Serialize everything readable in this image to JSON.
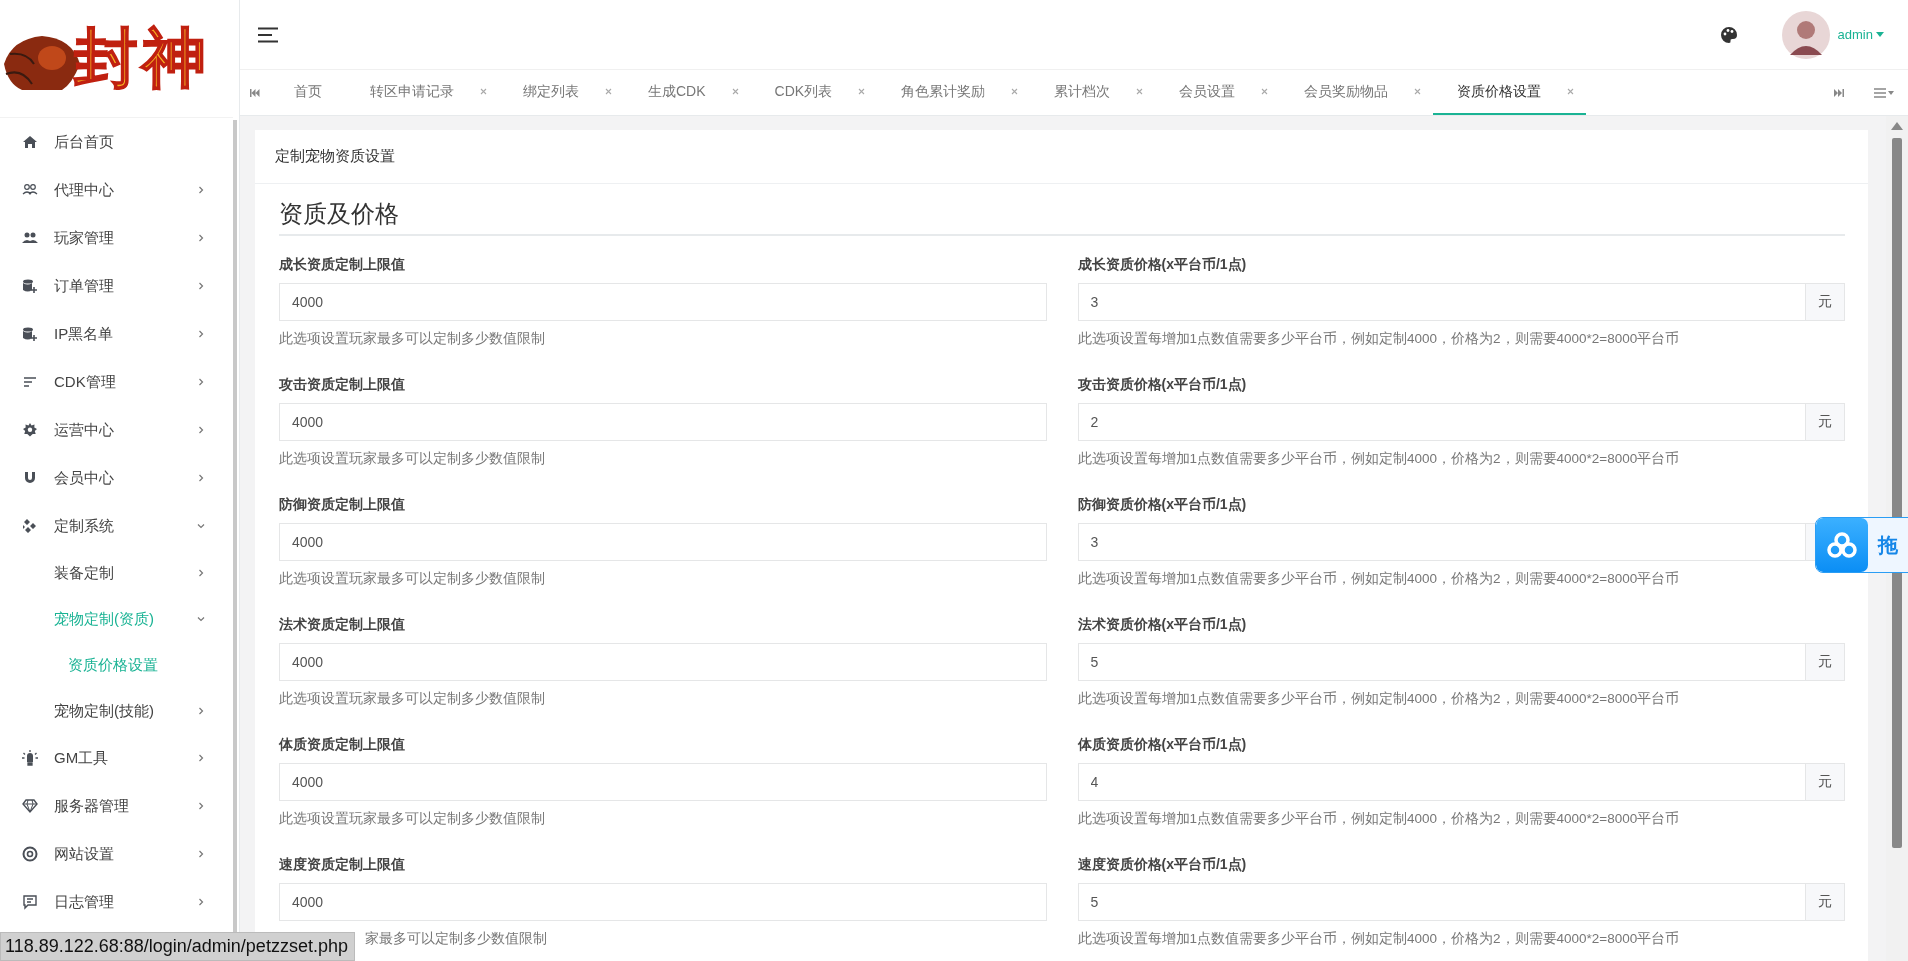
{
  "logo": {
    "text": "封神"
  },
  "sidebar": {
    "items": [
      {
        "label": "后台首页",
        "selected": false
      },
      {
        "label": "代理中心",
        "selected": false,
        "expanded": false
      },
      {
        "label": "玩家管理",
        "selected": false,
        "expanded": false
      },
      {
        "label": "订单管理",
        "selected": false,
        "expanded": false
      },
      {
        "label": "IP黑名单",
        "selected": false,
        "expanded": false
      },
      {
        "label": "CDK管理",
        "selected": false,
        "expanded": false
      },
      {
        "label": "运营中心",
        "selected": false,
        "expanded": false
      },
      {
        "label": "会员中心",
        "selected": false,
        "expanded": false
      },
      {
        "label": "定制系统",
        "selected": false,
        "expanded": true,
        "children": [
          {
            "label": "装备定制",
            "selected": false,
            "expanded": false
          },
          {
            "label": "宠物定制(资质)",
            "selected": true,
            "expanded": true,
            "children": [
              {
                "label": "资质价格设置",
                "selected": true
              }
            ]
          },
          {
            "label": "宠物定制(技能)",
            "selected": false,
            "expanded": false
          }
        ]
      },
      {
        "label": "GM工具",
        "selected": false,
        "expanded": false
      },
      {
        "label": "服务器管理",
        "selected": false,
        "expanded": false
      },
      {
        "label": "网站设置",
        "selected": false,
        "expanded": false
      },
      {
        "label": "日志管理",
        "selected": false,
        "expanded": false
      }
    ]
  },
  "header": {
    "user": "admin"
  },
  "tabs": [
    {
      "label": "首页",
      "closable": false,
      "selected": false
    },
    {
      "label": "转区申请记录",
      "closable": true,
      "selected": false
    },
    {
      "label": "绑定列表",
      "closable": true,
      "selected": false
    },
    {
      "label": "生成CDK",
      "closable": true,
      "selected": false
    },
    {
      "label": "CDK列表",
      "closable": true,
      "selected": false
    },
    {
      "label": "角色累计奖励",
      "closable": true,
      "selected": false
    },
    {
      "label": "累计档次",
      "closable": true,
      "selected": false
    },
    {
      "label": "会员设置",
      "closable": true,
      "selected": false
    },
    {
      "label": "会员奖励物品",
      "closable": true,
      "selected": false
    },
    {
      "label": "资质价格设置",
      "closable": true,
      "selected": true
    }
  ],
  "card": {
    "title": "定制宠物资质设置",
    "section": "资质及价格",
    "rows": [
      {
        "left": {
          "label": "成长资质定制上限值",
          "value": "4000",
          "hint": "此选项设置玩家最多可以定制多少数值限制"
        },
        "right": {
          "label": "成长资质价格(x平台币/1点)",
          "value": "3",
          "unit": "元",
          "hint": "此选项设置每增加1点数值需要多少平台币，例如定制4000，价格为2，则需要4000*2=8000平台币"
        }
      },
      {
        "left": {
          "label": "攻击资质定制上限值",
          "value": "4000",
          "hint": "此选项设置玩家最多可以定制多少数值限制"
        },
        "right": {
          "label": "攻击资质价格(x平台币/1点)",
          "value": "2",
          "unit": "元",
          "hint": "此选项设置每增加1点数值需要多少平台币，例如定制4000，价格为2，则需要4000*2=8000平台币"
        }
      },
      {
        "left": {
          "label": "防御资质定制上限值",
          "value": "4000",
          "hint": "此选项设置玩家最多可以定制多少数值限制"
        },
        "right": {
          "label": "防御资质价格(x平台币/1点)",
          "value": "3",
          "hint": "此选项设置每增加1点数值需要多少平台币，例如定制4000，价格为2，则需要4000*2=8000平台币"
        }
      },
      {
        "left": {
          "label": "法术资质定制上限值",
          "value": "4000",
          "hint": "此选项设置玩家最多可以定制多少数值限制"
        },
        "right": {
          "label": "法术资质价格(x平台币/1点)",
          "value": "5",
          "unit": "元",
          "hint": "此选项设置每增加1点数值需要多少平台币，例如定制4000，价格为2，则需要4000*2=8000平台币"
        }
      },
      {
        "left": {
          "label": "体质资质定制上限值",
          "value": "4000",
          "hint": "此选项设置玩家最多可以定制多少数值限制"
        },
        "right": {
          "label": "体质资质价格(x平台币/1点)",
          "value": "4",
          "unit": "元",
          "hint": "此选项设置每增加1点数值需要多少平台币，例如定制4000，价格为2，则需要4000*2=8000平台币"
        }
      },
      {
        "left": {
          "label": "速度资质定制上限值",
          "value": "4000",
          "hint": "家最多可以定制多少数值限制"
        },
        "right": {
          "label": "速度资质价格(x平台币/1点)",
          "value": "5",
          "unit": "元",
          "hint": "此选项设置每增加1点数值需要多少平台币，例如定制4000，价格为2，则需要4000*2=8000平台币"
        }
      }
    ]
  },
  "float_button": {
    "label": "拖"
  },
  "status_bar": {
    "url": "118.89.122.68:88/login/admin/petzzset.php"
  }
}
